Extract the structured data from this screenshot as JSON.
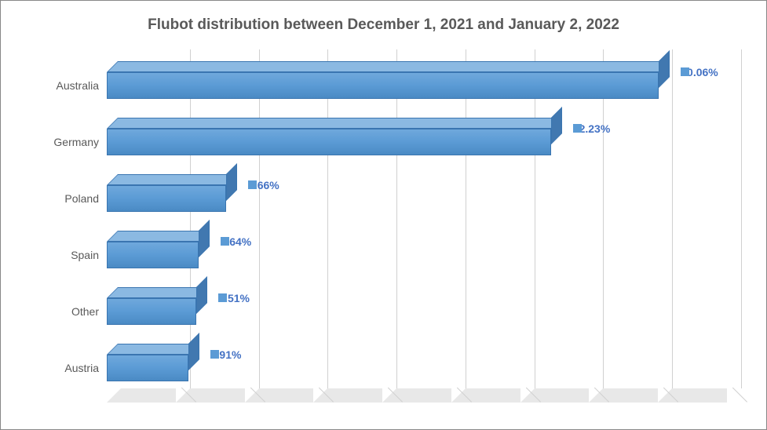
{
  "chart_data": {
    "type": "bar",
    "orientation": "horizontal",
    "title": "Flubot distribution between December 1, 2021 and January 2, 2022",
    "categories": [
      "Australia",
      "Germany",
      "Poland",
      "Spain",
      "Other",
      "Austria"
    ],
    "values": [
      40.06,
      32.23,
      8.66,
      6.64,
      6.51,
      5.91
    ],
    "value_labels": [
      "40.06%",
      "32.23%",
      "8.66%",
      "6.64%",
      "6.51%",
      "5.91%"
    ],
    "xlim": [
      0,
      45
    ],
    "x_ticks": [
      0,
      5,
      10,
      15,
      20,
      25,
      30,
      35,
      40,
      45
    ],
    "xlabel": "",
    "ylabel": "",
    "bar_color": "#5b9bd5",
    "style": "3d"
  }
}
